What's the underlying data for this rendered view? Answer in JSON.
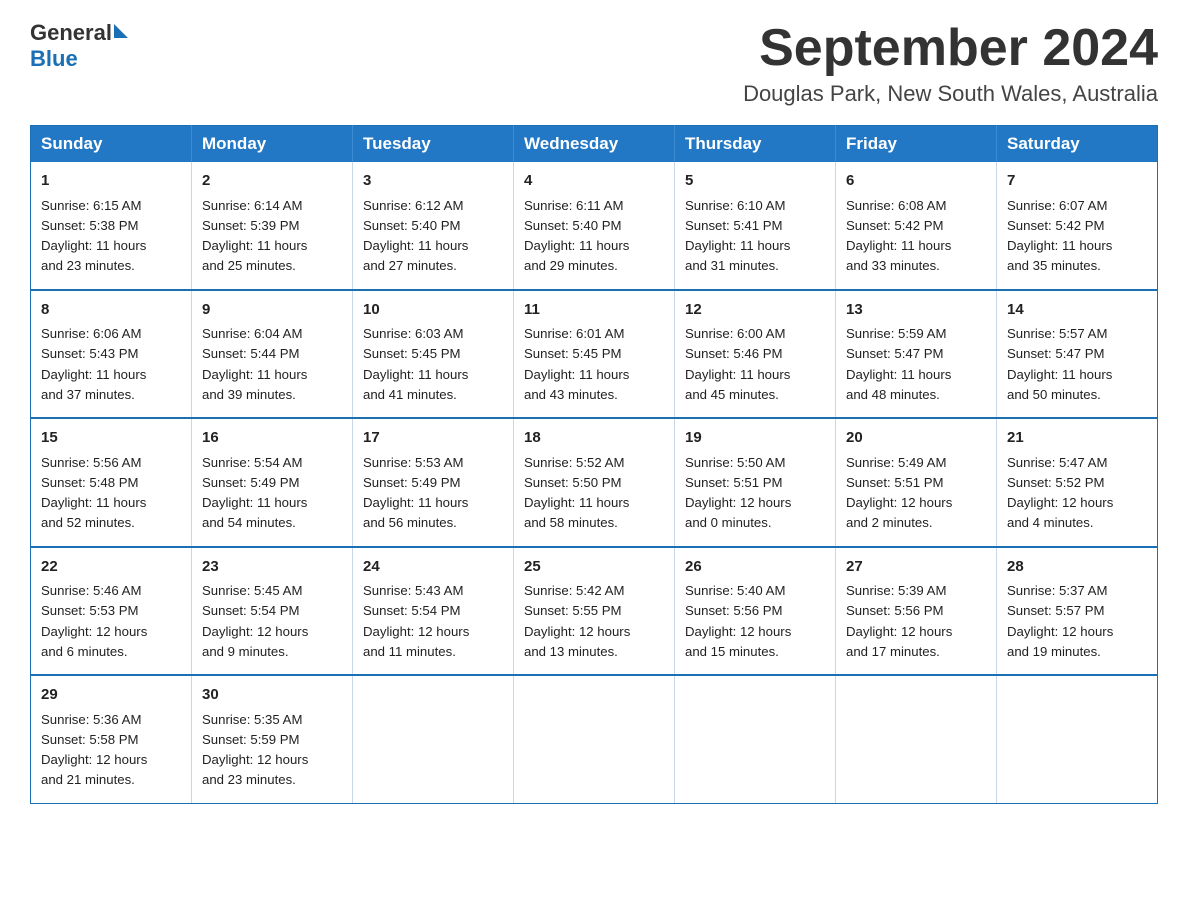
{
  "header": {
    "logo_general": "General",
    "logo_blue": "Blue",
    "month_title": "September 2024",
    "location": "Douglas Park, New South Wales, Australia"
  },
  "weekdays": [
    "Sunday",
    "Monday",
    "Tuesday",
    "Wednesday",
    "Thursday",
    "Friday",
    "Saturday"
  ],
  "weeks": [
    [
      {
        "day": "1",
        "sunrise": "6:15 AM",
        "sunset": "5:38 PM",
        "daylight": "11 hours and 23 minutes."
      },
      {
        "day": "2",
        "sunrise": "6:14 AM",
        "sunset": "5:39 PM",
        "daylight": "11 hours and 25 minutes."
      },
      {
        "day": "3",
        "sunrise": "6:12 AM",
        "sunset": "5:40 PM",
        "daylight": "11 hours and 27 minutes."
      },
      {
        "day": "4",
        "sunrise": "6:11 AM",
        "sunset": "5:40 PM",
        "daylight": "11 hours and 29 minutes."
      },
      {
        "day": "5",
        "sunrise": "6:10 AM",
        "sunset": "5:41 PM",
        "daylight": "11 hours and 31 minutes."
      },
      {
        "day": "6",
        "sunrise": "6:08 AM",
        "sunset": "5:42 PM",
        "daylight": "11 hours and 33 minutes."
      },
      {
        "day": "7",
        "sunrise": "6:07 AM",
        "sunset": "5:42 PM",
        "daylight": "11 hours and 35 minutes."
      }
    ],
    [
      {
        "day": "8",
        "sunrise": "6:06 AM",
        "sunset": "5:43 PM",
        "daylight": "11 hours and 37 minutes."
      },
      {
        "day": "9",
        "sunrise": "6:04 AM",
        "sunset": "5:44 PM",
        "daylight": "11 hours and 39 minutes."
      },
      {
        "day": "10",
        "sunrise": "6:03 AM",
        "sunset": "5:45 PM",
        "daylight": "11 hours and 41 minutes."
      },
      {
        "day": "11",
        "sunrise": "6:01 AM",
        "sunset": "5:45 PM",
        "daylight": "11 hours and 43 minutes."
      },
      {
        "day": "12",
        "sunrise": "6:00 AM",
        "sunset": "5:46 PM",
        "daylight": "11 hours and 45 minutes."
      },
      {
        "day": "13",
        "sunrise": "5:59 AM",
        "sunset": "5:47 PM",
        "daylight": "11 hours and 48 minutes."
      },
      {
        "day": "14",
        "sunrise": "5:57 AM",
        "sunset": "5:47 PM",
        "daylight": "11 hours and 50 minutes."
      }
    ],
    [
      {
        "day": "15",
        "sunrise": "5:56 AM",
        "sunset": "5:48 PM",
        "daylight": "11 hours and 52 minutes."
      },
      {
        "day": "16",
        "sunrise": "5:54 AM",
        "sunset": "5:49 PM",
        "daylight": "11 hours and 54 minutes."
      },
      {
        "day": "17",
        "sunrise": "5:53 AM",
        "sunset": "5:49 PM",
        "daylight": "11 hours and 56 minutes."
      },
      {
        "day": "18",
        "sunrise": "5:52 AM",
        "sunset": "5:50 PM",
        "daylight": "11 hours and 58 minutes."
      },
      {
        "day": "19",
        "sunrise": "5:50 AM",
        "sunset": "5:51 PM",
        "daylight": "12 hours and 0 minutes."
      },
      {
        "day": "20",
        "sunrise": "5:49 AM",
        "sunset": "5:51 PM",
        "daylight": "12 hours and 2 minutes."
      },
      {
        "day": "21",
        "sunrise": "5:47 AM",
        "sunset": "5:52 PM",
        "daylight": "12 hours and 4 minutes."
      }
    ],
    [
      {
        "day": "22",
        "sunrise": "5:46 AM",
        "sunset": "5:53 PM",
        "daylight": "12 hours and 6 minutes."
      },
      {
        "day": "23",
        "sunrise": "5:45 AM",
        "sunset": "5:54 PM",
        "daylight": "12 hours and 9 minutes."
      },
      {
        "day": "24",
        "sunrise": "5:43 AM",
        "sunset": "5:54 PM",
        "daylight": "12 hours and 11 minutes."
      },
      {
        "day": "25",
        "sunrise": "5:42 AM",
        "sunset": "5:55 PM",
        "daylight": "12 hours and 13 minutes."
      },
      {
        "day": "26",
        "sunrise": "5:40 AM",
        "sunset": "5:56 PM",
        "daylight": "12 hours and 15 minutes."
      },
      {
        "day": "27",
        "sunrise": "5:39 AM",
        "sunset": "5:56 PM",
        "daylight": "12 hours and 17 minutes."
      },
      {
        "day": "28",
        "sunrise": "5:37 AM",
        "sunset": "5:57 PM",
        "daylight": "12 hours and 19 minutes."
      }
    ],
    [
      {
        "day": "29",
        "sunrise": "5:36 AM",
        "sunset": "5:58 PM",
        "daylight": "12 hours and 21 minutes."
      },
      {
        "day": "30",
        "sunrise": "5:35 AM",
        "sunset": "5:59 PM",
        "daylight": "12 hours and 23 minutes."
      },
      null,
      null,
      null,
      null,
      null
    ]
  ],
  "labels": {
    "sunrise": "Sunrise:",
    "sunset": "Sunset:",
    "daylight": "Daylight:"
  }
}
